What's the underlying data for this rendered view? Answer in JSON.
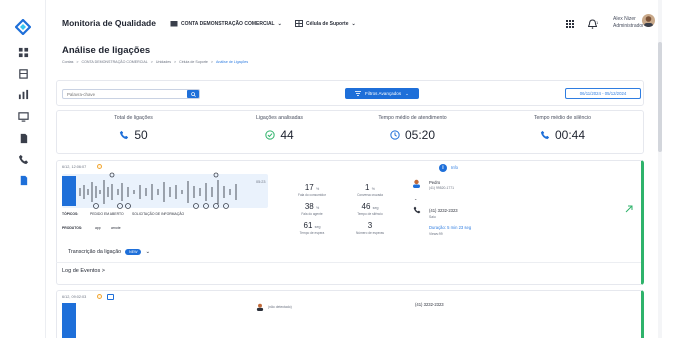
{
  "header": {
    "app_title": "Monitoria de Qualidade",
    "account_selector": "CONTA DEMONSTRAÇÃO COMERCIAL",
    "unit_selector": "Célula de Suporte",
    "notifications_count": "1",
    "user_name": "Alex Nizer",
    "user_role": "Administrador"
  },
  "page": {
    "title": "Análise de ligações",
    "breadcrumb": [
      "Contas",
      ">",
      "CONTA DEMONSTRAÇÃO COMERCIAL",
      ">",
      "Unidades",
      ">",
      "Célula de Suporte",
      ">",
      "Análise de Ligações"
    ]
  },
  "filters": {
    "search_placeholder": "Palavra-chave",
    "advanced_label": "Filtros Avançados",
    "date_range": "06/11/2024 - 05/12/2024"
  },
  "metrics": [
    {
      "label": "Total de ligações",
      "value": "50",
      "icon": "phone-icon"
    },
    {
      "label": "Ligações analisadas",
      "value": "44",
      "icon": "check-circle-icon"
    },
    {
      "label": "Tempo médio de atendimento",
      "value": "05:20",
      "icon": "clock-icon"
    },
    {
      "label": "Tempo médio de silêncio",
      "value": "00:44",
      "icon": "phone-silent-icon"
    }
  ],
  "call_card": {
    "datetime": "6/12, 12:06:07",
    "waveform_time": "05:23",
    "topics_label": "TÓPICOS:",
    "topics": [
      "PEDIDO EM ABERTO",
      "SOLICITAÇÃO DE INFORMAÇÃO"
    ],
    "products_label": "PRODUTOS:",
    "products": [
      "app",
      "arnote"
    ],
    "transcription_label": "Transcrição da ligação",
    "transcription_badge": "NEW",
    "stats": [
      {
        "value": "17",
        "unit": "%",
        "label": "Fala do consumidor"
      },
      {
        "value": "1",
        "unit": "%",
        "label": "Conversa cruzada"
      },
      {
        "value": "38",
        "unit": "%",
        "label": "Fala do agente"
      },
      {
        "value": "46",
        "unit": "seg",
        "label": "Tempo de silêncio"
      },
      {
        "value": "61",
        "unit": "seg",
        "label": "Tempo de espera"
      },
      {
        "value": "3",
        "unit": "",
        "label": "Número de esperas"
      }
    ],
    "info_label": "Info",
    "agent_name": "Pedro",
    "agent_phone": "(41) 99520-1771",
    "customer_phone": "(41) 3232-2323",
    "direction": "Saiu",
    "duration_label": "Duração:",
    "duration_value": "5 min 23 seg",
    "call_id": "Views:99"
  },
  "log": {
    "label": "Log de Eventos >"
  },
  "call_card2": {
    "datetime": "6/12, 09:02:03",
    "agent_name": "(não detectado)",
    "customer_phone": "(41) 3232-2323"
  }
}
